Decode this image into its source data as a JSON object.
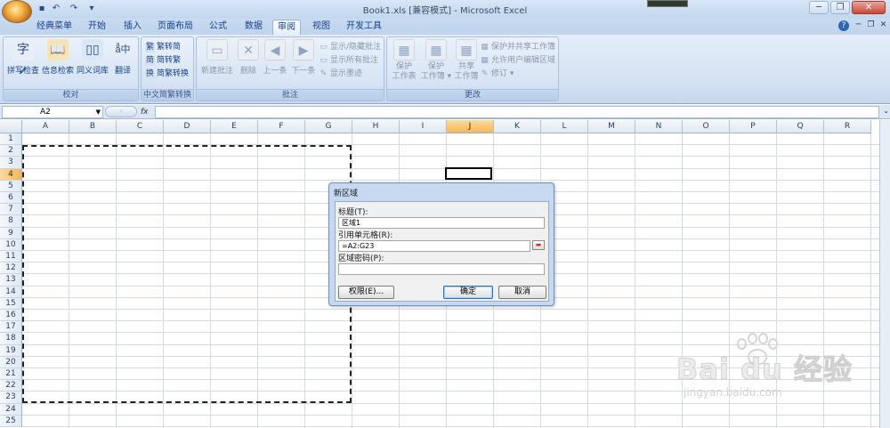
{
  "window": {
    "title": "Book1.xls  [兼容模式] - Microsoft Excel",
    "controls": {
      "minimize": "─",
      "maximize": "❐",
      "close": "✕"
    }
  },
  "ribbon_tabs": [
    "经典菜单",
    "开始",
    "插入",
    "页面布局",
    "公式",
    "数据",
    "审阅",
    "视图",
    "开发工具"
  ],
  "active_tab": "审阅",
  "ribbon": {
    "proofing": {
      "label": "校对",
      "buttons": [
        "拼写检查",
        "信息检索",
        "同义词库",
        "翻译"
      ]
    },
    "chinese_conversion": {
      "label": "中文简繁转换",
      "buttons": [
        "繁转简",
        "简转繁",
        "简繁转换"
      ]
    },
    "comments": {
      "label": "批注",
      "buttons": [
        "新建批注",
        "删除",
        "上一条",
        "下一条"
      ],
      "small_buttons": [
        "显示/隐藏批注",
        "显示所有批注",
        "显示墨迹"
      ]
    },
    "changes": {
      "label": "更改",
      "buttons": [
        {
          "line1": "保护",
          "line2": "工作表"
        },
        {
          "line1": "保护",
          "line2": "工作簿 ▾"
        },
        {
          "line1": "共享",
          "line2": "工作簿"
        }
      ],
      "small_buttons": [
        "保护并共享工作簿",
        "允许用户编辑区域",
        "修订 ▾"
      ]
    }
  },
  "formula_bar": {
    "name_box": "A2",
    "fx": "fx",
    "formula": ""
  },
  "grid": {
    "columns": [
      "A",
      "B",
      "C",
      "D",
      "E",
      "F",
      "G",
      "H",
      "I",
      "J",
      "K",
      "L",
      "M",
      "N",
      "O",
      "P",
      "Q",
      "R"
    ],
    "rows": [
      "1",
      "2",
      "3",
      "4",
      "5",
      "6",
      "7",
      "8",
      "9",
      "10",
      "11",
      "12",
      "13",
      "14",
      "15",
      "16",
      "17",
      "18",
      "19",
      "20",
      "21",
      "22",
      "23",
      "24",
      "25"
    ],
    "selected_column": "J",
    "selected_row": "4"
  },
  "dialog": {
    "title": "新区域",
    "title_label": "标题(T):",
    "title_value": "区域1",
    "ref_label": "引用单元格(R):",
    "ref_value": "=A2:G23",
    "password_label": "区域密码(P):",
    "password_value": "",
    "permissions_button": "权限(E)...",
    "ok_button": "确定",
    "cancel_button": "取消"
  },
  "watermark": {
    "text": "Bai du 经验",
    "sub": "jingyan.baidu.com"
  }
}
